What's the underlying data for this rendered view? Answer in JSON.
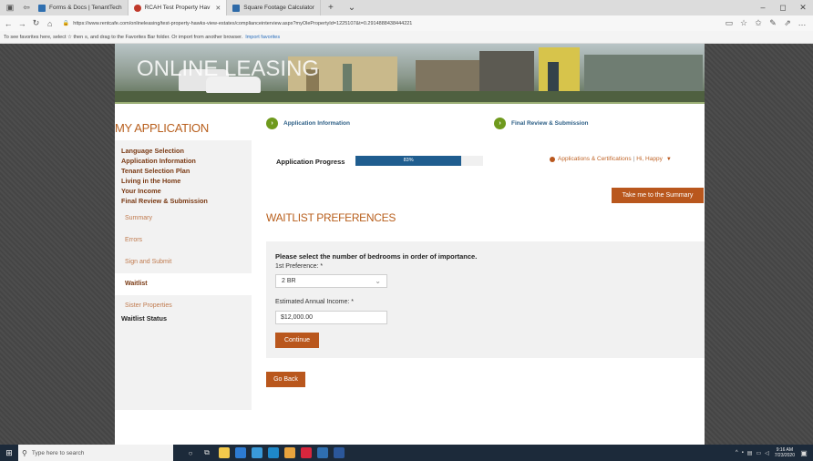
{
  "browser": {
    "tabs": [
      {
        "title": "Forms & Docs | TenantTech",
        "color": "#2f6fb0"
      },
      {
        "title": "RCAH Test Property Hav",
        "color": "#c0392b"
      },
      {
        "title": "Square Footage Calculator",
        "color": "#2e6aa8"
      }
    ],
    "url": "https://www.rentcafe.com/onlineleasing/test-property-hawks-view-estates/complianceinterview.aspx?myOlePropertyId=1225107&t=0.2914888438444221",
    "favbar_text": "To see favorites here, select ☆ then ≡, and drag to the Favorites Bar folder. Or import from another browser.",
    "favbar_link": "Import favorites"
  },
  "banner": {
    "logo": "ONLINE LEASING"
  },
  "sidebar": {
    "title": "MY APPLICATION",
    "main_items": [
      "Language Selection",
      "Application Information",
      "Tenant Selection Plan",
      "Living in the Home",
      "Your Income",
      "Final Review & Submission"
    ],
    "sub_items": [
      "Summary",
      "Errors",
      "Sign and Submit"
    ],
    "active_item": "Waitlist",
    "after_items": [
      "Sister Properties"
    ],
    "status_item": "Waitlist Status"
  },
  "steps": {
    "step1": "Application Information",
    "step2": "Final Review & Submission",
    "arrow": "›"
  },
  "progress": {
    "label": "Application Progress",
    "percent_text": "83%",
    "value": 0.83
  },
  "user_menu": {
    "link": "Applications & Certifications",
    "separator": "|",
    "greeting": "Hi, Happy",
    "caret": "▼"
  },
  "summary_button": "Take me to the Summary",
  "waitlist": {
    "title": "WAITLIST PREFERENCES",
    "heading": "Please select the number of bedrooms in order of importance.",
    "pref_label": "1st Preference: *",
    "pref_value": "2 BR",
    "income_label": "Estimated Annual Income: *",
    "income_value": "$12,000.00",
    "continue": "Continue"
  },
  "go_back": "Go Back",
  "taskbar": {
    "search_placeholder": "Type here to search",
    "time": "9:16 AM",
    "date": "7/23/2020"
  },
  "colors": {
    "accent": "#b9571d",
    "progress": "#1f5d8f",
    "step_dot": "#6f9a1d",
    "link": "#2d5f86"
  }
}
